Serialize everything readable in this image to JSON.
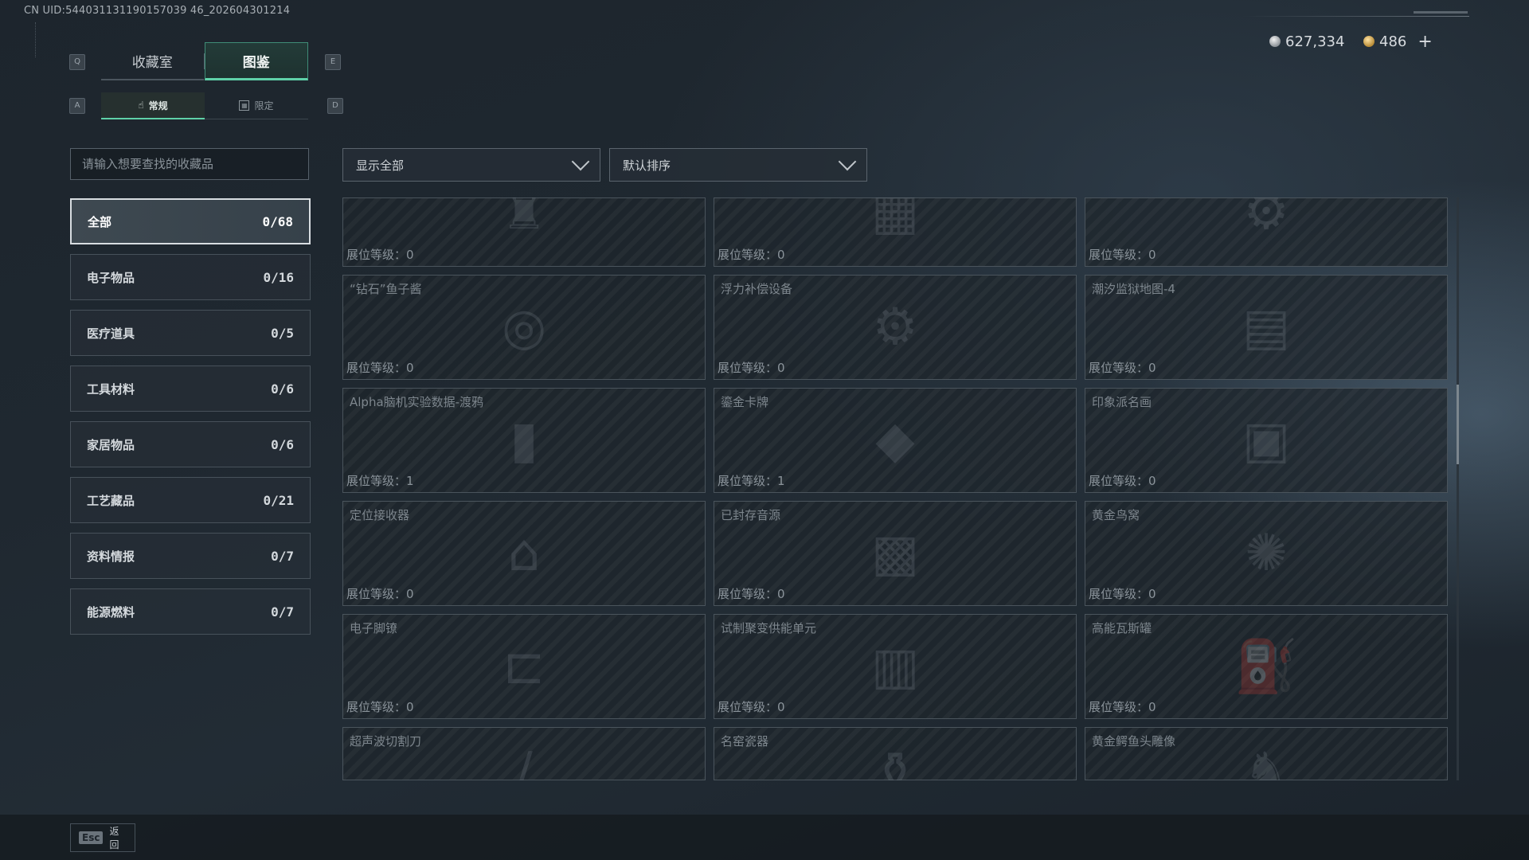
{
  "uid_text": "CN UID:544031131190157039 46_202604301214",
  "keys": {
    "q": "Q",
    "e": "E",
    "a": "A",
    "d": "D"
  },
  "tabs": [
    {
      "label": "收藏室",
      "active": false
    },
    {
      "label": "图鉴",
      "active": true
    }
  ],
  "subtabs": [
    {
      "label": "常规",
      "icon": "hand-icon",
      "active": true
    },
    {
      "label": "限定",
      "icon": "limited-icon",
      "active": false
    }
  ],
  "currency": {
    "silver": "627,334",
    "gold": "486",
    "plus": "+"
  },
  "search": {
    "placeholder": "请输入想要查找的收藏品"
  },
  "filters": {
    "show_all": "显示全部",
    "sort": "默认排序"
  },
  "categories": [
    {
      "label": "全部",
      "count": "0/68",
      "active": true
    },
    {
      "label": "电子物品",
      "count": "0/16"
    },
    {
      "label": "医疗道具",
      "count": "0/5"
    },
    {
      "label": "工具材料",
      "count": "0/6"
    },
    {
      "label": "家居物品",
      "count": "0/6"
    },
    {
      "label": "工艺藏品",
      "count": "0/21"
    },
    {
      "label": "资料情报",
      "count": "0/7"
    },
    {
      "label": "能源燃料",
      "count": "0/7"
    }
  ],
  "level_prefix": "展位等级：",
  "items": [
    {
      "name": "",
      "level": "0",
      "art": "trophy"
    },
    {
      "name": "",
      "level": "0",
      "art": "board"
    },
    {
      "name": "",
      "level": "0",
      "art": "device"
    },
    {
      "name": "“钻石”鱼子酱",
      "level": "0",
      "art": "tin"
    },
    {
      "name": "浮力补偿设备",
      "level": "0",
      "art": "gear"
    },
    {
      "name": "潮汐监狱地图-4",
      "level": "0",
      "art": "map"
    },
    {
      "name": "Alpha脑机实验数据-渡鸦",
      "level": "1",
      "art": "drive"
    },
    {
      "name": "鎏金卡牌",
      "level": "1",
      "art": "card"
    },
    {
      "name": "印象派名画",
      "level": "0",
      "art": "frame"
    },
    {
      "name": "定位接收器",
      "level": "0",
      "art": "receiver"
    },
    {
      "name": "已封存音源",
      "level": "0",
      "art": "box"
    },
    {
      "name": "黄金鸟窝",
      "level": "0",
      "art": "nest"
    },
    {
      "name": "电子脚镣",
      "level": "0",
      "art": "shackle"
    },
    {
      "name": "试制聚变供能单元",
      "level": "0",
      "art": "cell"
    },
    {
      "name": "高能瓦斯罐",
      "level": "0",
      "art": "canister"
    },
    {
      "name": "超声波切割刀",
      "level": "",
      "art": "blade"
    },
    {
      "name": "名窑瓷器",
      "level": "",
      "art": "vase"
    },
    {
      "name": "黄金鳄鱼头雕像",
      "level": "",
      "art": "statue"
    }
  ],
  "footer": {
    "esc_key": "Esc",
    "back_label": "返回"
  }
}
